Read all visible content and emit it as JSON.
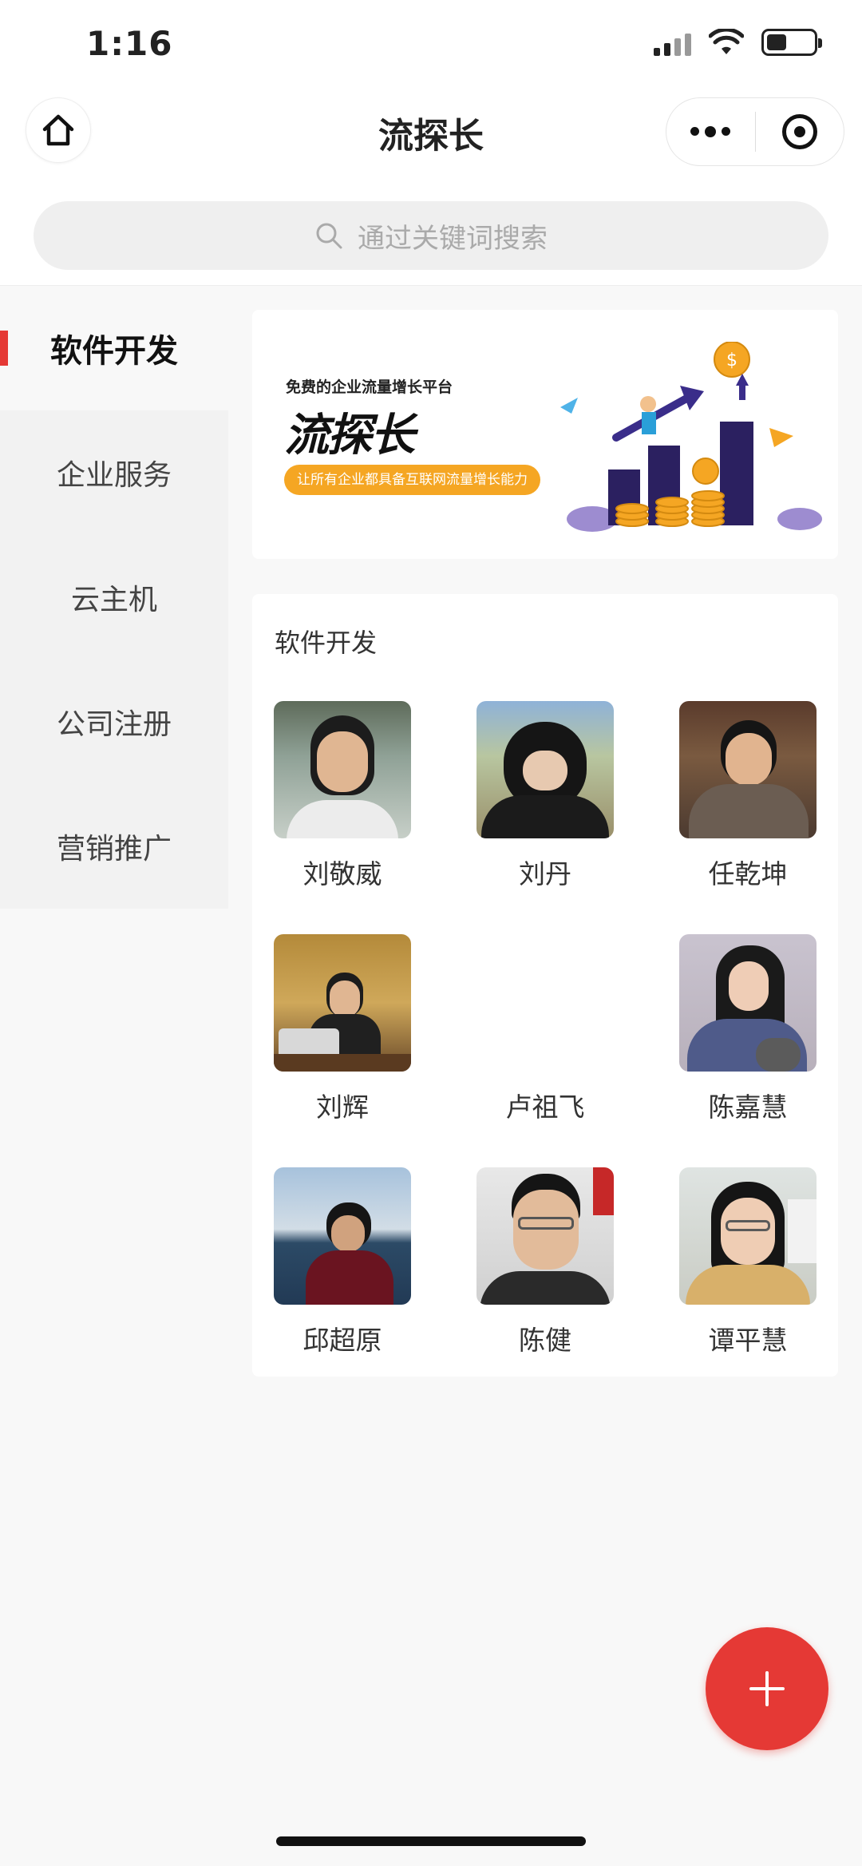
{
  "status_bar": {
    "time": "1:16"
  },
  "nav": {
    "title": "流探长"
  },
  "search": {
    "placeholder": "通过关键词搜索"
  },
  "sidebar": {
    "items": [
      {
        "label": "软件开发",
        "active": true
      },
      {
        "label": "企业服务",
        "active": false
      },
      {
        "label": "云主机",
        "active": false
      },
      {
        "label": "公司注册",
        "active": false
      },
      {
        "label": "营销推广",
        "active": false
      }
    ]
  },
  "banner": {
    "subtitle": "免费的企业流量增长平台",
    "logo_text": "流探长",
    "tagline": "让所有企业都具备互联网流量增长能力"
  },
  "section": {
    "title": "软件开发",
    "people": [
      {
        "name": "刘敬威"
      },
      {
        "name": "刘丹"
      },
      {
        "name": "任乾坤"
      },
      {
        "name": "刘辉"
      },
      {
        "name": "卢祖飞"
      },
      {
        "name": "陈嘉慧"
      },
      {
        "name": "邱超原"
      },
      {
        "name": "陈健"
      },
      {
        "name": "谭平慧"
      }
    ]
  },
  "colors": {
    "accent": "#e53935",
    "banner_orange": "#f5a623"
  },
  "fab": {
    "icon": "plus-icon"
  }
}
